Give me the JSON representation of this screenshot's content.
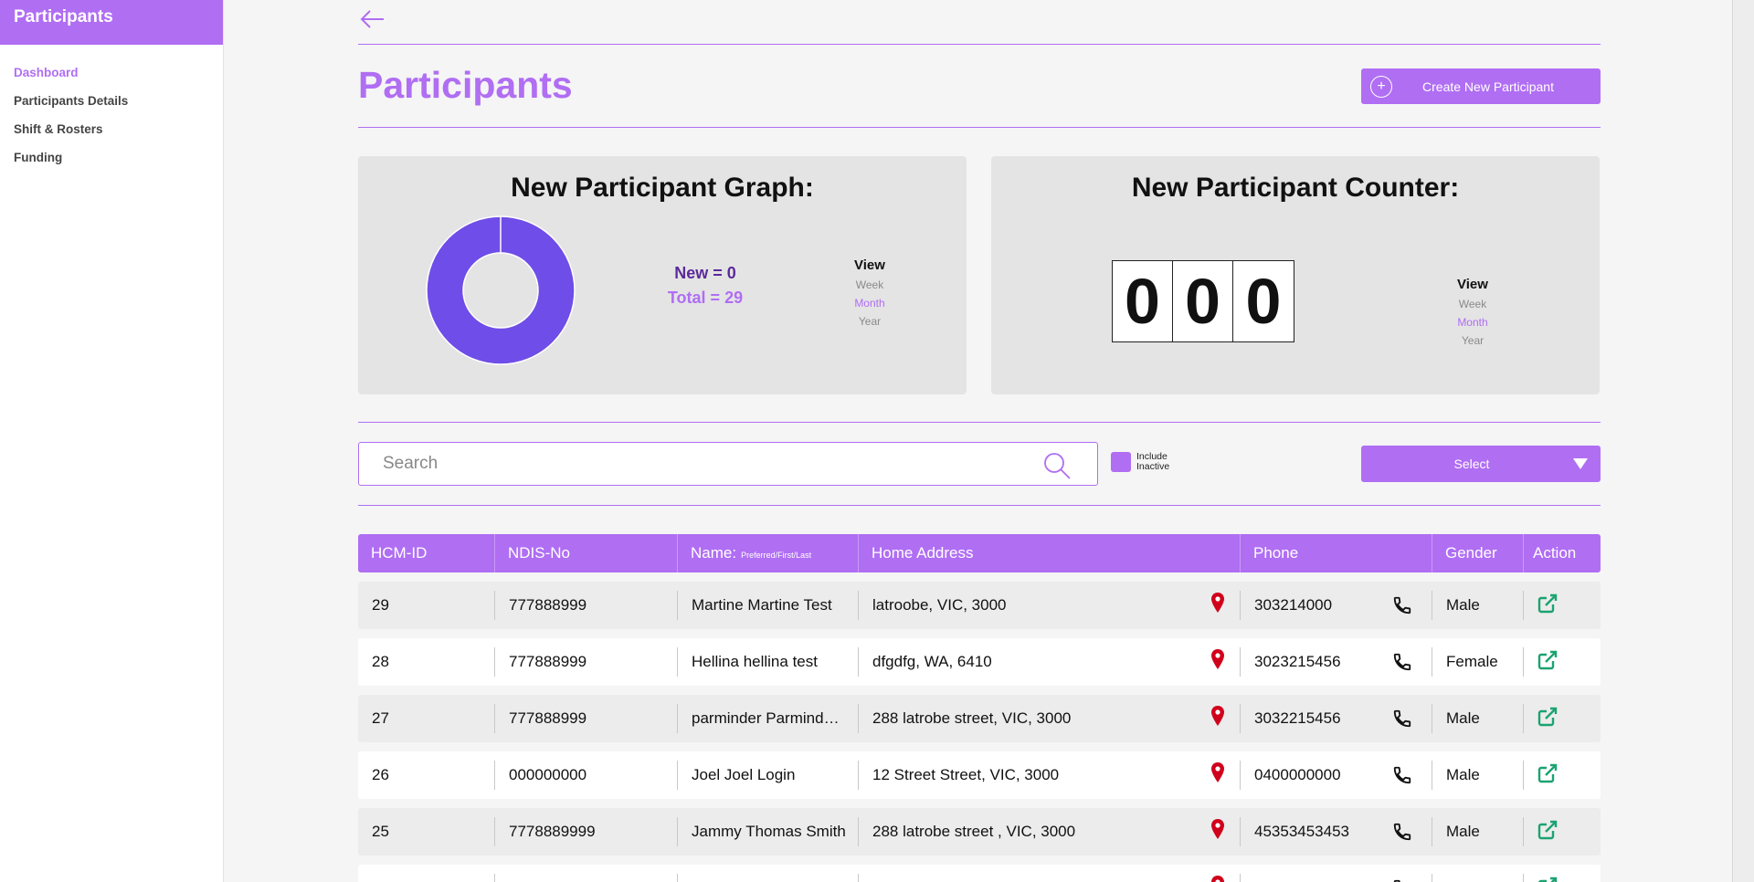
{
  "sidebar": {
    "title": "Participants",
    "items": [
      {
        "label": "Dashboard",
        "active": true
      },
      {
        "label": "Participants Details",
        "active": false
      },
      {
        "label": "Shift & Rosters",
        "active": false
      },
      {
        "label": "Funding",
        "active": false
      }
    ]
  },
  "header": {
    "title": "Participants",
    "create_button": "Create New Participant"
  },
  "graph_card": {
    "title": "New Participant Graph:",
    "new_label": "New = 0",
    "total_label": "Total = 29",
    "new_value": 0,
    "total_value": 29,
    "view": {
      "title": "View",
      "options": [
        "Week",
        "Month",
        "Year"
      ],
      "selected": "Month"
    }
  },
  "counter_card": {
    "title": "New Participant Counter:",
    "digits": [
      "0",
      "0",
      "0"
    ],
    "view": {
      "title": "View",
      "options": [
        "Week",
        "Month",
        "Year"
      ],
      "selected": "Month"
    }
  },
  "search": {
    "placeholder": "Search",
    "value": "",
    "include_inactive_label": "Include Inactive",
    "include_inactive_checked": true,
    "select_label": "Select"
  },
  "table": {
    "columns": [
      "HCM-ID",
      "NDIS-No",
      "Name:",
      "Home Address",
      "Phone",
      "Gender",
      "Action"
    ],
    "name_sub": "Preferred/First/Last",
    "rows": [
      {
        "id": "29",
        "ndis": "777888999",
        "name": "Martine Martine Test",
        "address": "latroobe, VIC, 3000",
        "phone": "303214000",
        "gender": "Male"
      },
      {
        "id": "28",
        "ndis": "777888999",
        "name": "Hellina hellina test",
        "address": "dfgdfg, WA, 6410",
        "phone": "3023215456",
        "gender": "Female"
      },
      {
        "id": "27",
        "ndis": "777888999",
        "name": "parminder Parminder Test",
        "address": "288 latrobe street, VIC, 3000",
        "phone": "3032215456",
        "gender": "Male"
      },
      {
        "id": "26",
        "ndis": "000000000",
        "name": "Joel Joel Login",
        "address": "12 Street Street, VIC, 3000",
        "phone": "0400000000",
        "gender": "Male"
      },
      {
        "id": "25",
        "ndis": "7778889999",
        "name": "Jammy Thomas Smith",
        "address": "288 latrobe street , VIC, 3000",
        "phone": "45353453453",
        "gender": "Male"
      },
      {
        "id": "",
        "ndis": "",
        "name": "",
        "address": "",
        "phone": "",
        "gender": ""
      }
    ]
  },
  "colors": {
    "accent": "#b06ef3",
    "donut": "#6f4de8",
    "pin": "#d0021b",
    "action": "#1aa371"
  },
  "icons": {
    "back": "arrow-left-icon",
    "search": "magnifier-icon",
    "pin": "map-pin-icon",
    "phone": "phone-icon",
    "action": "external-link-icon"
  }
}
